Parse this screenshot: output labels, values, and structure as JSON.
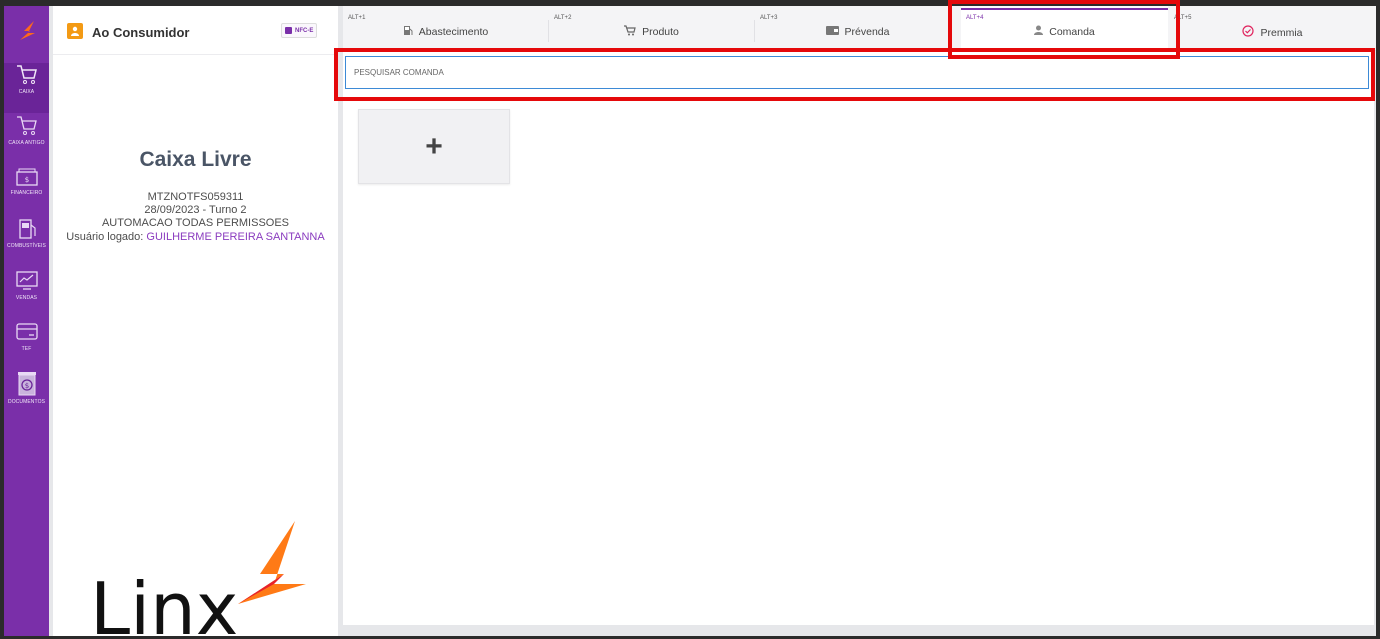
{
  "sidebar": {
    "items": [
      {
        "label": "CAIXA",
        "icon": "cart-icon"
      },
      {
        "label": "CAIXA ANTIGO",
        "icon": "cart-outline-icon"
      },
      {
        "label": "FINANCEIRO",
        "icon": "cash-icon"
      },
      {
        "label": "COMBUSTÍVEIS",
        "icon": "fuel-pump-icon"
      },
      {
        "label": "VENDAS",
        "icon": "chart-monitor-icon"
      },
      {
        "label": "TEF",
        "icon": "credit-card-icon"
      },
      {
        "label": "DOCUMENTOS",
        "icon": "document-dollar-icon"
      }
    ]
  },
  "customer": {
    "name": "Ao Consumidor",
    "badge": "NFC-E",
    "status_title": "Caixa Livre",
    "terminal": "MTZNOTFS059311",
    "date_shift": "28/09/2023 - Turno 2",
    "profile": "AUTOMACAO TODAS PERMISSOES",
    "user_label": "Usuário logado: ",
    "user_name": "GUILHERME PEREIRA SANTANNA",
    "logo_text": "Linx"
  },
  "tabs": [
    {
      "key": "ALT+1",
      "label": "Abastecimento",
      "icon": "fuel-pump-icon"
    },
    {
      "key": "ALT+2",
      "label": "Produto",
      "icon": "shopping-cart-icon"
    },
    {
      "key": "ALT+3",
      "label": "Prévenda",
      "icon": "wallet-icon"
    },
    {
      "key": "ALT+4",
      "label": "Comanda",
      "icon": "person-icon"
    },
    {
      "key": "ALT+5",
      "label": "Premmia",
      "icon": "check-circle-icon"
    }
  ],
  "active_tab": "Comanda",
  "search": {
    "placeholder": "PESQUISAR COMANDA",
    "value": ""
  },
  "add_button": {
    "label": "+"
  },
  "colors": {
    "brand": "#7a2fa9",
    "accent": "#f39a14",
    "highlight": "#e5090b",
    "user_name": "#8a3bbf"
  }
}
